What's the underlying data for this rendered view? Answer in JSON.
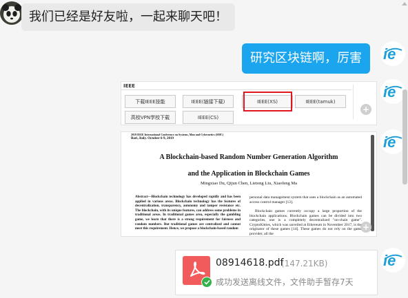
{
  "messages": {
    "incoming_text": "我们已经是好友啦，一起来聊天吧！",
    "outgoing_text": "研究区块链啊，厉害"
  },
  "screenshot1": {
    "tab_label": "IEEE",
    "buttons": [
      "下载IEEE技能",
      "IEEE(链接下载)",
      "IEEE(XS)",
      "IEEE(tamuk)",
      "高校VPN学校下载",
      "IEEE(CS)"
    ],
    "highlight_color": "#e0161c"
  },
  "paper": {
    "header_line1": "2019 IEEE International Conference on Systems, Man and Cybernetics (SMC)",
    "header_line2": "Bari, Italy. October 6-9, 2019",
    "title_line1": "A Blockchain-based Random Number Generation Algorithm",
    "title_line2": "and the Application in Blockchain Games",
    "authors": "Mingxiao Du, Qijun Chen, Lietong Liu, Xiaofeng Ma",
    "abstract_left": "Abstract—Blockchain technology has developed rapidly and has been applied in various areas. Blockchain technology has the features of decentralization, transparency, autonomy and tamper resistance etc. The blockchain, with its unique features, can address some problems in traditional areas. In traditional games area, especially the gambling game, we learn that there is a strong requirement for fairness and random numbers. But traditional games are centralized and cannot meet this requirement. Hence, we propose a blockchain-based random",
    "right_col_p1": "personal data management system that uses a blockchain as an automated access control manager [13].",
    "right_col_p2": "Blockchain games currently occupy a large proportion of the blockchain applications. Blockchain games can be divided into two categories, one is a completely decentralized \"on-chain game\". CryptoKitties, which was unveiled at Ethereum in November 2017, is the originator of these games [14]. These games do not rely on the game provider, all the"
  },
  "file": {
    "name": "08914618.pdf",
    "size": "(147.21KB)",
    "status": "成功发送离线文件，文件助手暂存7天",
    "type_icon": "pdf-icon"
  },
  "colors": {
    "outgoing_bubble": "#1ba5ee",
    "incoming_bubble": "#e9e9e9",
    "pdf_icon": "#f25b5b",
    "success": "#33b24a",
    "ie_logo": "#1f9fd8"
  }
}
